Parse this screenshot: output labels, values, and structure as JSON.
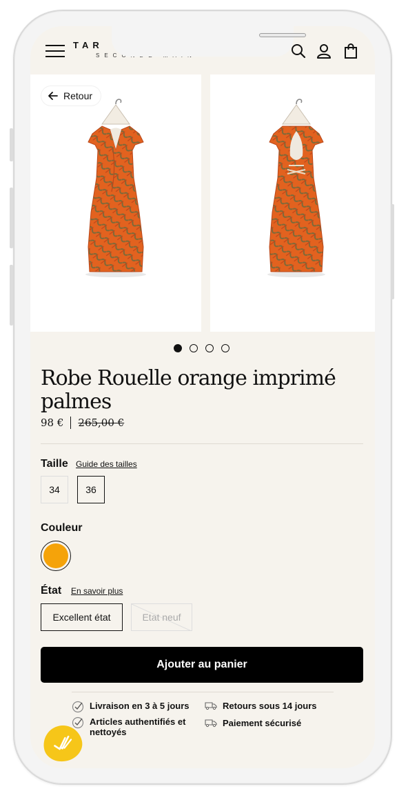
{
  "header": {
    "logo": "TAR",
    "logo_sub": "SECONDE MAIN"
  },
  "gallery": {
    "back_label": "Retour",
    "slide_count": 4,
    "active_slide": 1
  },
  "product": {
    "title": "Robe Rouelle orange imprimé palmes",
    "price": "98 €",
    "original_price": "265,00 €"
  },
  "size": {
    "label": "Taille",
    "guide_link": "Guide des tailles",
    "options": [
      "34",
      "36"
    ],
    "selected": "36"
  },
  "color": {
    "label": "Couleur",
    "swatch": "#f5a30a"
  },
  "condition": {
    "label": "État",
    "more_link": "En savoir plus",
    "options": [
      "Excellent état",
      "Etat neuf"
    ],
    "selected": "Excellent état"
  },
  "cart": {
    "button_label": "Ajouter au panier"
  },
  "features": {
    "delivery": "Livraison en 3 à 5 jours",
    "returns": "Retours sous 14 jours",
    "authentic": "Articles authentifiés et nettoyés",
    "payment": "Paiement sécurisé"
  },
  "colors": {
    "background": "#f6f3ed",
    "primary": "#000000",
    "accent": "#f5a30a",
    "badge": "#f6c619"
  }
}
